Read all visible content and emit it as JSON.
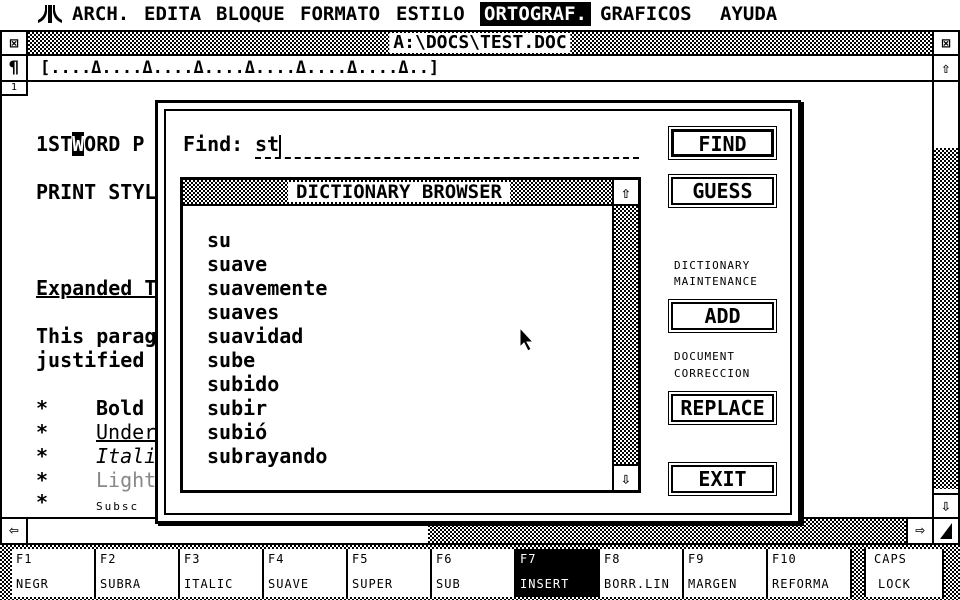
{
  "menu": {
    "items": [
      {
        "label": "ARCH.",
        "selected": false
      },
      {
        "label": "EDITA",
        "selected": false
      },
      {
        "label": "BLOQUE",
        "selected": false
      },
      {
        "label": "FORMATO",
        "selected": false
      },
      {
        "label": "ESTILO",
        "selected": false
      },
      {
        "label": "ORTOGRAF.",
        "selected": true
      },
      {
        "label": "GRAFICOS",
        "selected": false
      },
      {
        "label": "AYUDA",
        "selected": false
      }
    ]
  },
  "window": {
    "title": "A:\\DOCS\\TEST.DOC",
    "ruler": "[....Δ....Δ....Δ....Δ....Δ....Δ....Δ..]",
    "page_number": "1",
    "icons": {
      "close": "close-icon",
      "fuller": "fuller-icon",
      "paragraph": "paragraph-icon"
    }
  },
  "document": {
    "line1_before": "1ST",
    "line1_cursor": "W",
    "line1_after": "ORD P",
    "line2": "PRINT STYL",
    "heading": "Expanded T",
    "para1": "This parag",
    "para2": "justified ",
    "bullet": "*",
    "bullets": [
      "Bold",
      "Under",
      "Itali",
      "Light",
      "Subsc"
    ]
  },
  "dialog": {
    "find_label": "Find:",
    "find_value": "st",
    "find_button": "FIND",
    "guess_button": "GUESS",
    "maintenance_label_1": "DICTIONARY",
    "maintenance_label_2": "MAINTENANCE",
    "add_button": "ADD",
    "document_label_1": "DOCUMENT",
    "document_label_2": "CORRECCION",
    "replace_button": "REPLACE",
    "exit_button": "EXIT",
    "browser": {
      "title": "DICTIONARY BROWSER",
      "words": [
        "su",
        "suave",
        "suavemente",
        "suaves",
        "suavidad",
        "sube",
        "subido",
        "subir",
        "subió",
        "subrayando"
      ]
    }
  },
  "function_keys": [
    {
      "key": "F1",
      "label": "NEGR",
      "active": false
    },
    {
      "key": "F2",
      "label": "SUBRA",
      "active": false
    },
    {
      "key": "F3",
      "label": "ITALIC",
      "active": false
    },
    {
      "key": "F4",
      "label": "SUAVE",
      "active": false
    },
    {
      "key": "F5",
      "label": "SUPER",
      "active": false
    },
    {
      "key": "F6",
      "label": "SUB",
      "active": false
    },
    {
      "key": "F7",
      "label": "INSERT",
      "active": true
    },
    {
      "key": "F8",
      "label": "BORR.LIN",
      "active": false
    },
    {
      "key": "F9",
      "label": "MARGEN",
      "active": false
    },
    {
      "key": "F10",
      "label": "REFORMA",
      "active": false
    }
  ],
  "caps": {
    "top": "CAPS",
    "bottom": "LOCK"
  }
}
